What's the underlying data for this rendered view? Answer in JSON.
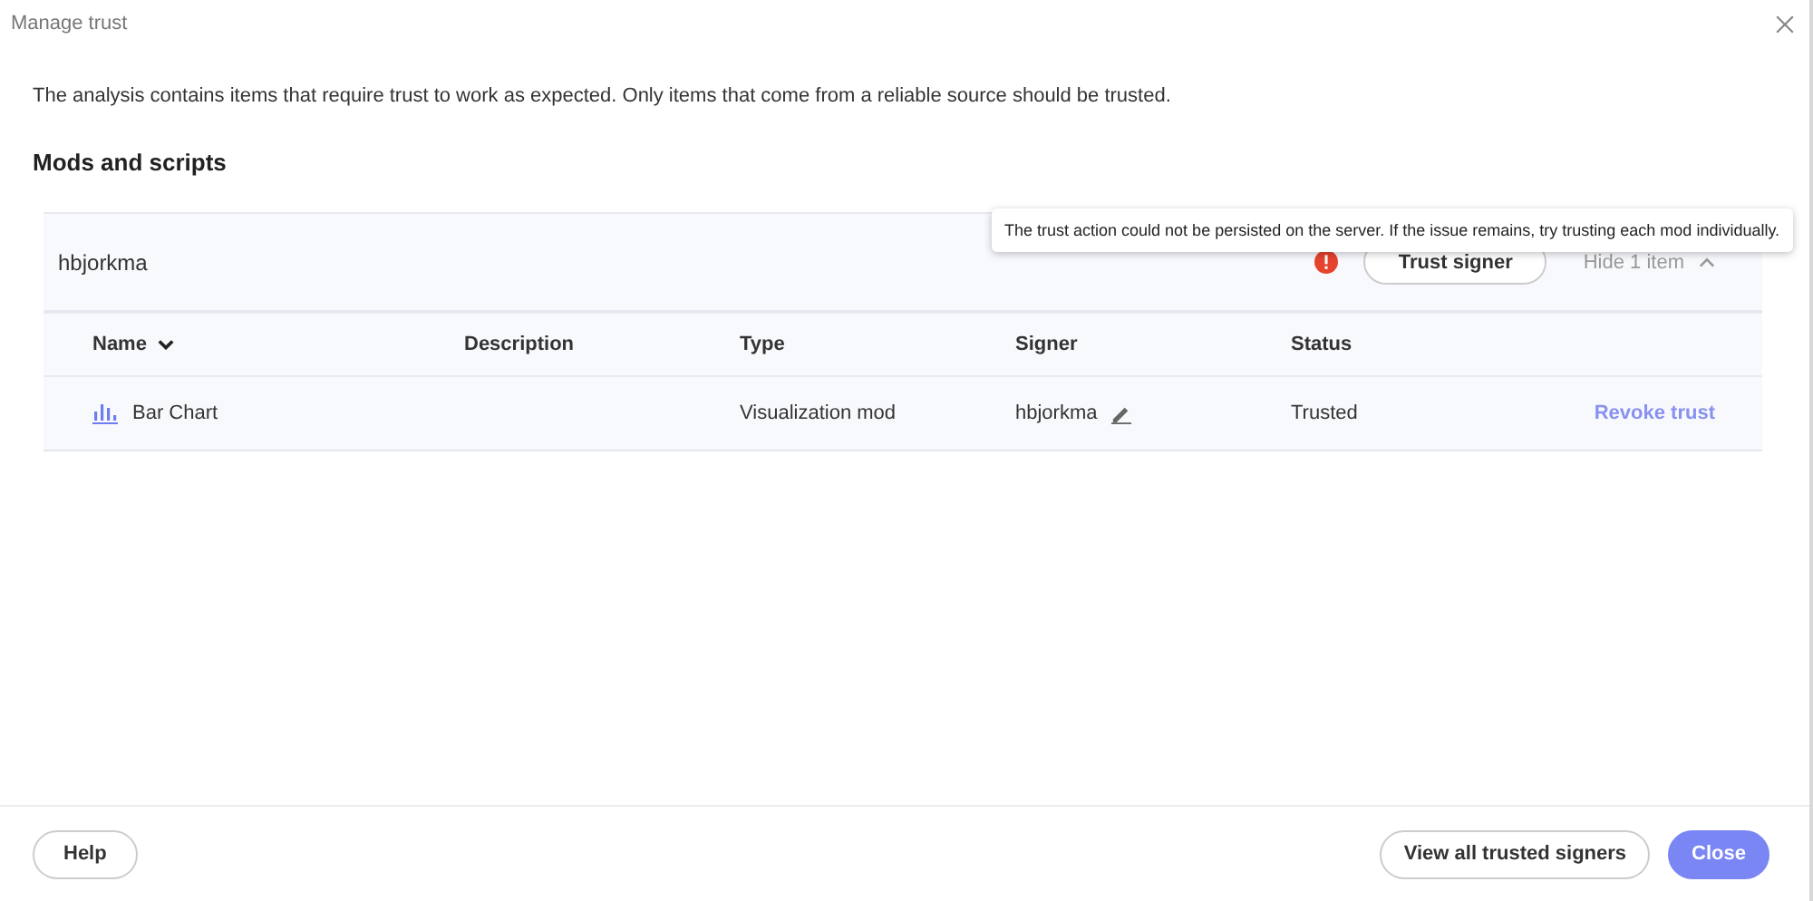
{
  "dialog": {
    "title": "Manage trust",
    "description": "The analysis contains items that require trust to work as expected. Only items that come from a reliable source should be trusted."
  },
  "section": {
    "heading": "Mods and scripts"
  },
  "group": {
    "signer": "hbjorkma",
    "error": true,
    "tooltip": "The trust action could not be persisted on the server. If the issue remains, try trusting each mod individually.",
    "trust_button": "Trust signer",
    "toggle": "Hide 1 item",
    "expanded": true
  },
  "table": {
    "columns": [
      {
        "label": "Name",
        "sorted": true
      },
      {
        "label": "Description",
        "sorted": false
      },
      {
        "label": "Type",
        "sorted": false
      },
      {
        "label": "Signer",
        "sorted": false
      },
      {
        "label": "Status",
        "sorted": false
      }
    ],
    "rows": [
      {
        "name": "Bar Chart",
        "description": "",
        "type": "Visualization mod",
        "signer": "hbjorkma",
        "status": "Trusted",
        "action": "Revoke trust"
      }
    ]
  },
  "footer": {
    "help": "Help",
    "view_all": "View all trusted signers",
    "close": "Close"
  }
}
